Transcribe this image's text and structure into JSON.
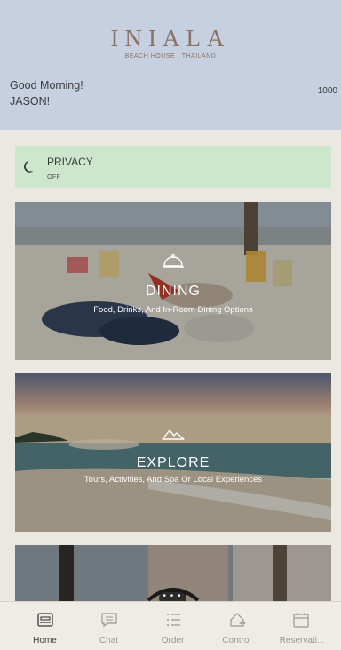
{
  "header": {
    "logo": "INIALA",
    "logo_sub": "BEACH HOUSE · THAILAND",
    "greeting_line1": "Good Morning!",
    "greeting_line2": "JASON!",
    "points": "1000"
  },
  "privacy": {
    "title": "PRIVACY",
    "state": "OFF",
    "icon": "moon-icon"
  },
  "cards": [
    {
      "title": "DINING",
      "subtitle": "Food, Drinks, And In-Room Dining Options",
      "icon": "cloche-icon"
    },
    {
      "title": "EXPLORE",
      "subtitle": "Tours, Activities, And Spa Or Local Experiences",
      "icon": "mountain-icon"
    },
    {
      "title": "",
      "subtitle": "",
      "icon": "telephone-icon"
    }
  ],
  "scroll_indicator": "• • •",
  "tabs": [
    {
      "label": "Home",
      "icon": "bed-icon",
      "active": true
    },
    {
      "label": "Chat",
      "icon": "chat-icon",
      "active": false
    },
    {
      "label": "Order",
      "icon": "list-icon",
      "active": false
    },
    {
      "label": "Control",
      "icon": "home-control-icon",
      "active": false
    },
    {
      "label": "Reservati...",
      "icon": "calendar-icon",
      "active": false
    }
  ],
  "colors": {
    "header_bg": "#c6d0e1",
    "privacy_bg": "#cde7cd",
    "page_bg": "#ebe8e1",
    "logo": "#8a7262"
  }
}
